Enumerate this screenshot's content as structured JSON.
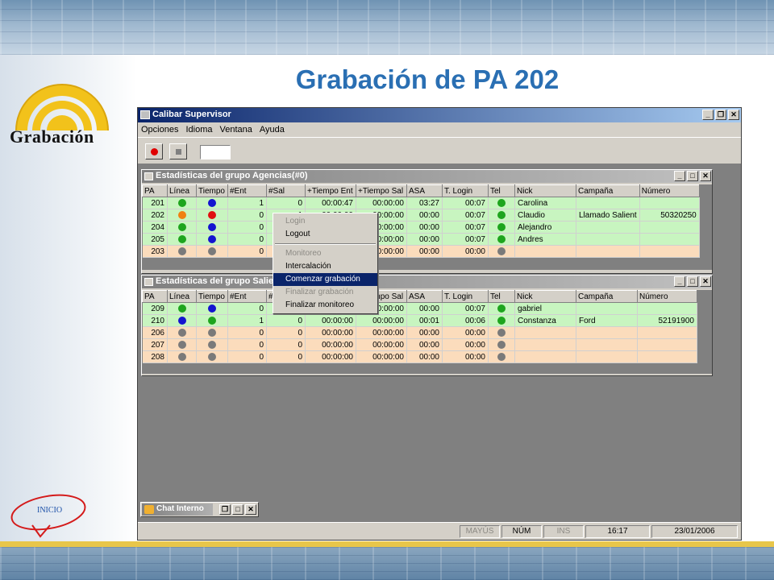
{
  "slide": {
    "title": "Grabación de PA 202",
    "logo_text": "Grabación",
    "inicio_label": "INICIO"
  },
  "app": {
    "title": "Calibar Supervisor",
    "menu": [
      "Opciones",
      "Idioma",
      "Ventana",
      "Ayuda"
    ],
    "window_buttons": [
      "_",
      "🗗",
      "✕"
    ]
  },
  "columns": [
    "PA",
    "Línea",
    "Tiempo",
    "#Ent",
    "#Sal",
    "+Tiempo Ent",
    "+Tiempo Sal",
    "ASA",
    "T. Login",
    "Tel",
    "Nick",
    "Campaña",
    "Número"
  ],
  "colors": {
    "green": "#1ea51e",
    "blue": "#1414d0",
    "orange": "#f08010",
    "red": "#e01010",
    "gray": "#7a7a7a",
    "row_active": "#c8f5c0",
    "row_inactive": "#fbdcbc",
    "selection": "#0a246a"
  },
  "agencias": {
    "title": "Estadísticas del grupo Agencias(#0)",
    "rows": [
      {
        "pa": "201",
        "linea": "green",
        "tiempo": "blue",
        "ent": "1",
        "sal": "0",
        "tent": "00:00:47",
        "tsal": "00:00:00",
        "asa": "03:27",
        "tlogin": "00:07",
        "tel": "green",
        "nick": "Carolina",
        "campana": "",
        "numero": "",
        "state": "green"
      },
      {
        "pa": "202",
        "linea": "orange",
        "tiempo": "red",
        "ent": "0",
        "sal": "1",
        "tent": "00:00:00",
        "tsal": "00:00:00",
        "asa": "00:00",
        "tlogin": "00:07",
        "tel": "green",
        "nick": "Claudio",
        "campana": "Llamado Salient",
        "numero": "50320250",
        "state": "green"
      },
      {
        "pa": "204",
        "linea": "green",
        "tiempo": "blue",
        "ent": "0",
        "sal": "0",
        "tent": "00:00:00",
        "tsal": "00:00:00",
        "asa": "00:00",
        "tlogin": "00:07",
        "tel": "green",
        "nick": "Alejandro",
        "campana": "",
        "numero": "",
        "state": "green"
      },
      {
        "pa": "205",
        "linea": "green",
        "tiempo": "blue",
        "ent": "0",
        "sal": "0",
        "tent": "00:00:00",
        "tsal": "00:00:00",
        "asa": "00:00",
        "tlogin": "00:07",
        "tel": "green",
        "nick": "Andres",
        "campana": "",
        "numero": "",
        "state": "green"
      },
      {
        "pa": "203",
        "linea": "gray",
        "tiempo": "gray",
        "ent": "0",
        "sal": "0",
        "tent": "00:00:00",
        "tsal": "00:00:00",
        "asa": "00:00",
        "tlogin": "00:00",
        "tel": "gray",
        "nick": "",
        "campana": "",
        "numero": "",
        "state": "peach"
      }
    ]
  },
  "salientes": {
    "title": "Estadísticas del grupo Salie",
    "rows": [
      {
        "pa": "209",
        "linea": "green",
        "tiempo": "blue",
        "ent": "0",
        "sal": "0",
        "tent": "00:00:00",
        "tsal": "00:00:00",
        "asa": "00:00",
        "tlogin": "00:07",
        "tel": "green",
        "nick": "gabriel",
        "campana": "",
        "numero": "",
        "state": "green"
      },
      {
        "pa": "210",
        "linea": "blue",
        "tiempo": "green",
        "ent": "1",
        "sal": "0",
        "tent": "00:00:00",
        "tsal": "00:00:00",
        "asa": "00:01",
        "tlogin": "00:06",
        "tel": "green",
        "nick": "Constanza",
        "campana": "Ford",
        "numero": "52191900",
        "state": "green"
      },
      {
        "pa": "206",
        "linea": "gray",
        "tiempo": "gray",
        "ent": "0",
        "sal": "0",
        "tent": "00:00:00",
        "tsal": "00:00:00",
        "asa": "00:00",
        "tlogin": "00:00",
        "tel": "gray",
        "nick": "",
        "campana": "",
        "numero": "",
        "state": "peach"
      },
      {
        "pa": "207",
        "linea": "gray",
        "tiempo": "gray",
        "ent": "0",
        "sal": "0",
        "tent": "00:00:00",
        "tsal": "00:00:00",
        "asa": "00:00",
        "tlogin": "00:00",
        "tel": "gray",
        "nick": "",
        "campana": "",
        "numero": "",
        "state": "peach"
      },
      {
        "pa": "208",
        "linea": "gray",
        "tiempo": "gray",
        "ent": "0",
        "sal": "0",
        "tent": "00:00:00",
        "tsal": "00:00:00",
        "asa": "00:00",
        "tlogin": "00:00",
        "tel": "gray",
        "nick": "",
        "campana": "",
        "numero": "",
        "state": "peach"
      }
    ]
  },
  "context_menu": {
    "items": [
      {
        "label": "Login",
        "enabled": false,
        "selected": false
      },
      {
        "label": "Logout",
        "enabled": true,
        "selected": false
      },
      {
        "sep": true
      },
      {
        "label": "Monitoreo",
        "enabled": false,
        "selected": false
      },
      {
        "label": "Intercalación",
        "enabled": true,
        "selected": false
      },
      {
        "label": "Comenzar grabación",
        "enabled": true,
        "selected": true
      },
      {
        "label": "Finalizar grabación",
        "enabled": false,
        "selected": false
      },
      {
        "label": "Finalizar monitoreo",
        "enabled": true,
        "selected": false
      }
    ]
  },
  "chat": {
    "title": "Chat Interno"
  },
  "status": {
    "mayus": "MAYÚS",
    "num": "NÚM",
    "ins": "INS",
    "time": "16:17",
    "date": "23/01/2006"
  }
}
